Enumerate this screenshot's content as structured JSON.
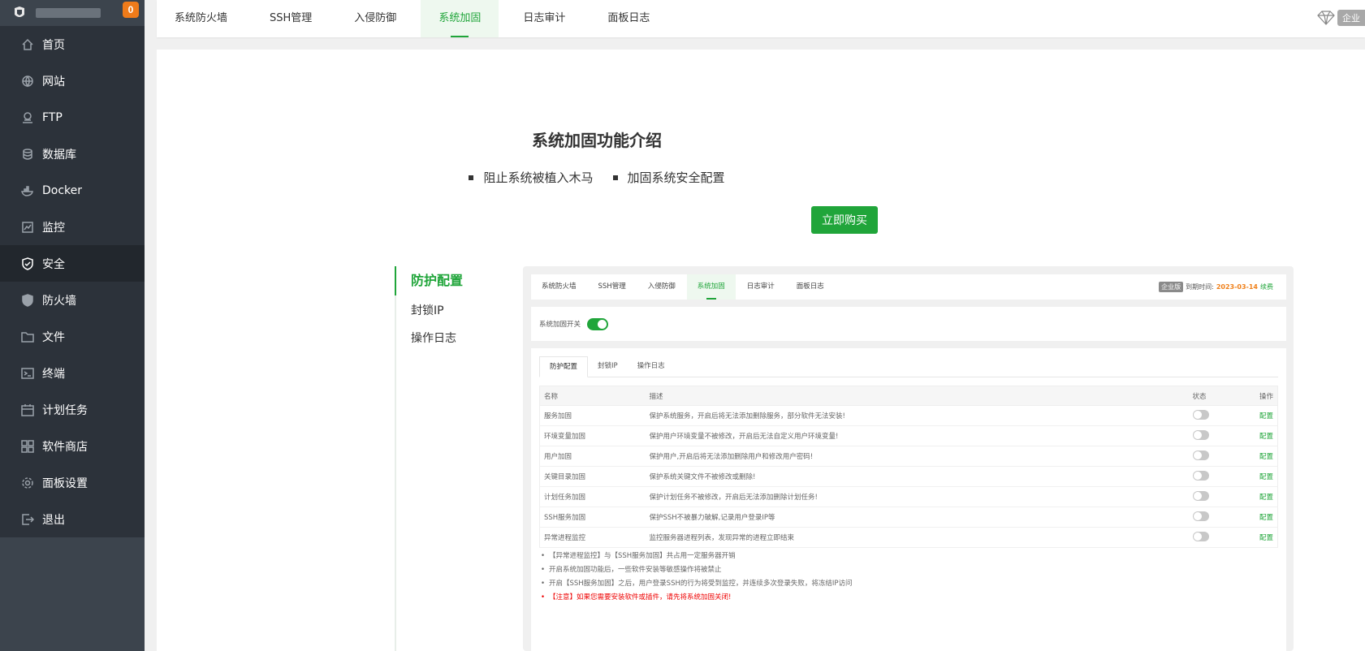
{
  "sidebar": {
    "badge": "0",
    "items": [
      {
        "label": "首页",
        "icon": "home-icon"
      },
      {
        "label": "网站",
        "icon": "globe-icon"
      },
      {
        "label": "FTP",
        "icon": "ftp-icon"
      },
      {
        "label": "数据库",
        "icon": "database-icon"
      },
      {
        "label": "Docker",
        "icon": "docker-icon"
      },
      {
        "label": "监控",
        "icon": "monitor-icon"
      },
      {
        "label": "安全",
        "icon": "shield-icon"
      },
      {
        "label": "防火墙",
        "icon": "firewall-icon"
      },
      {
        "label": "文件",
        "icon": "folder-icon"
      },
      {
        "label": "终端",
        "icon": "terminal-icon"
      },
      {
        "label": "计划任务",
        "icon": "calendar-icon"
      },
      {
        "label": "软件商店",
        "icon": "apps-icon"
      },
      {
        "label": "面板设置",
        "icon": "gear-icon"
      },
      {
        "label": "退出",
        "icon": "logout-icon"
      }
    ],
    "active_index": 6
  },
  "topbar": {
    "tabs": [
      "系统防火墙",
      "SSH管理",
      "入侵防御",
      "系统加固",
      "日志审计",
      "面板日志"
    ],
    "active_index": 3,
    "enterprise_label": "企业"
  },
  "main": {
    "title": "系统加固功能介绍",
    "features": [
      "阻止系统被植入木马",
      "加固系统安全配置"
    ],
    "buy_label": "立即购买",
    "subnav": [
      "防护配置",
      "封锁IP",
      "操作日志"
    ]
  },
  "preview": {
    "tabs": [
      "系统防火墙",
      "SSH管理",
      "入侵防御",
      "系统加固",
      "日志审计",
      "面板日志"
    ],
    "enterprise": "企业版",
    "expire_label": "到期时间:",
    "expire_date": "2023-03-14",
    "renew": "续费",
    "switch_label": "系统加固开关",
    "subtabs": [
      "防护配置",
      "封锁IP",
      "操作日志"
    ],
    "columns": [
      "名称",
      "描述",
      "状态",
      "操作"
    ],
    "rows": [
      {
        "name": "服务加固",
        "desc": "保护系统服务，开启后将无法添加删除服务，部分软件无法安装!",
        "op": "配置"
      },
      {
        "name": "环境变量加固",
        "desc": "保护用户环境变量不被修改，开启后无法自定义用户环境变量!",
        "op": "配置"
      },
      {
        "name": "用户加固",
        "desc": "保护用户,开启后将无法添加删除用户和修改用户密码!",
        "op": "配置"
      },
      {
        "name": "关键目录加固",
        "desc": "保护系统关键文件不被修改或删除!",
        "op": "配置"
      },
      {
        "name": "计划任务加固",
        "desc": "保护计划任务不被修改，开启后无法添加删除计划任务!",
        "op": "配置"
      },
      {
        "name": "SSH服务加固",
        "desc": "保护SSH不被暴力破解,记录用户登录IP等",
        "op": "配置"
      },
      {
        "name": "异常进程监控",
        "desc": "监控服务器进程列表，发现异常的进程立即结束",
        "op": "配置"
      }
    ],
    "notes": [
      "【异常进程监控】与【SSH服务加固】共占用一定服务器开销",
      "开启系统加固功能后，一些软件安装等敏感操作将被禁止",
      "开启【SSH服务加固】之后，用户登录SSH的行为将受到监控，并连续多次登录失败，将冻结IP访问",
      "【注意】如果您需要安装软件或插件，请先将系统加固关闭!"
    ]
  }
}
